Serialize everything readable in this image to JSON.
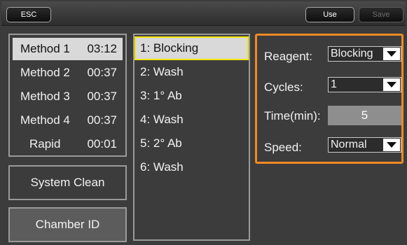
{
  "topbar": {
    "esc_label": "ESC",
    "use_label": "Use",
    "save_label": "Save"
  },
  "methods": [
    {
      "name": "Method 1",
      "time": "03:12",
      "selected": true
    },
    {
      "name": "Method 2",
      "time": "00:37",
      "selected": false
    },
    {
      "name": "Method 3",
      "time": "00:37",
      "selected": false
    },
    {
      "name": "Method 4",
      "time": "00:37",
      "selected": false
    },
    {
      "name": "Rapid",
      "time": "00:01",
      "selected": false
    }
  ],
  "buttons": {
    "system_clean": "System Clean",
    "chamber_id": "Chamber ID"
  },
  "steps": [
    {
      "label": "1: Blocking",
      "selected": true
    },
    {
      "label": "2: Wash",
      "selected": false
    },
    {
      "label": "3: 1° Ab",
      "selected": false
    },
    {
      "label": "4: Wash",
      "selected": false
    },
    {
      "label": "5: 2° Ab",
      "selected": false
    },
    {
      "label": "6: Wash",
      "selected": false
    }
  ],
  "settings": {
    "reagent_label": "Reagent:",
    "reagent_value": "Blocking",
    "cycles_label": "Cycles:",
    "cycles_value": "1",
    "time_label": "Time(min):",
    "time_value": "5",
    "speed_label": "Speed:",
    "speed_value": "Normal"
  },
  "colors": {
    "selection_outline": "#f2e40a",
    "settings_border": "#f08a22",
    "selected_bg": "#d9d9d9"
  }
}
